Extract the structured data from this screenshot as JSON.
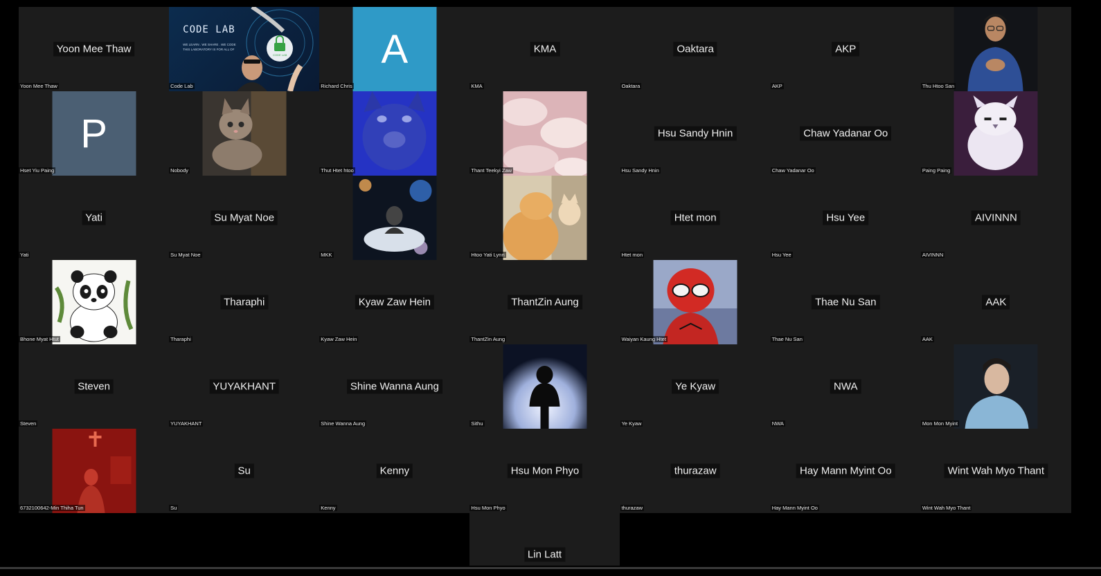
{
  "gallery": {
    "tiles": [
      {
        "display": "Yoon Mee Thaw",
        "label": "Yoon Mee Thaw"
      },
      {
        "display": "",
        "label": "Code Lab",
        "screen_heading": "CODE LAB",
        "screen_line1": "WE LEARN . WE SHARE . WE CODE",
        "screen_line2": "THIS LABORATORY IS FOR ALL OF",
        "lock_text": "CODE LAB"
      },
      {
        "display": "",
        "label": "Richard Chris",
        "avatar_letter": "A"
      },
      {
        "display": "KMA",
        "label": "KMA"
      },
      {
        "display": "Oaktara",
        "label": "Oaktara"
      },
      {
        "display": "AKP",
        "label": "AKP"
      },
      {
        "display": "",
        "label": "Thu Htoo San"
      },
      {
        "display": "",
        "label": "Hset Yiu Paing",
        "avatar_letter": "P"
      },
      {
        "display": "",
        "label": "Nobody"
      },
      {
        "display": "",
        "label": "Thut Htet htoo"
      },
      {
        "display": "",
        "label": "Thant Teekyi Zaw"
      },
      {
        "display": "Hsu Sandy Hnin",
        "label": "Hsu Sandy Hnin"
      },
      {
        "display": "Chaw Yadanar Oo",
        "label": "Chaw Yadanar Oo"
      },
      {
        "display": "",
        "label": "Paing Paing"
      },
      {
        "display": "Yati",
        "label": "Yati"
      },
      {
        "display": "Su Myat Noe",
        "label": "Su Myat Noe"
      },
      {
        "display": "",
        "label": "MKK"
      },
      {
        "display": "",
        "label": "Htoo Yati Lynn"
      },
      {
        "display": "Htet mon",
        "label": "Htet mon"
      },
      {
        "display": "Hsu Yee",
        "label": "Hsu Yee"
      },
      {
        "display": "AIVINNN",
        "label": "AIVINNN"
      },
      {
        "display": "",
        "label": "Bhone Myat Htut"
      },
      {
        "display": "Tharaphi",
        "label": "Tharaphi"
      },
      {
        "display": "Kyaw Zaw Hein",
        "label": "Kyaw Zaw Hein"
      },
      {
        "display": "ThantZin Aung",
        "label": "ThantZin Aung"
      },
      {
        "display": "",
        "label": "Waiyan Kaung Htet"
      },
      {
        "display": "Thae Nu San",
        "label": "Thae Nu San"
      },
      {
        "display": "AAK",
        "label": "AAK"
      },
      {
        "display": "Steven",
        "label": "Steven"
      },
      {
        "display": "YUYAKHANT",
        "label": "YUYAKHANT"
      },
      {
        "display": "Shine Wanna Aung",
        "label": "Shine Wanna Aung"
      },
      {
        "display": "",
        "label": "Sithu"
      },
      {
        "display": "Ye Kyaw",
        "label": "Ye Kyaw"
      },
      {
        "display": "NWA",
        "label": "NWA"
      },
      {
        "display": "",
        "label": "Mon Mon Myint"
      },
      {
        "display": "",
        "label": "6732100642-Min Thiha Tun"
      },
      {
        "display": "Su",
        "label": "Su"
      },
      {
        "display": "Kenny",
        "label": "Kenny"
      },
      {
        "display": "Hsu Mon Phyo",
        "label": "Hsu Mon Phyo"
      },
      {
        "display": "thurazaw",
        "label": "thurazaw"
      },
      {
        "display": "Hay Mann Myint Oo",
        "label": "Hay Mann Myint Oo"
      },
      {
        "display": "Wint Wah Myo Thant",
        "label": "Wint Wah Myo Thant"
      }
    ],
    "extra": {
      "display": "Lin Latt"
    }
  },
  "colors": {
    "tile_bg": "#1c1c1c",
    "avatar_A": "#2f9ac7",
    "avatar_P": "#4b5f73"
  }
}
